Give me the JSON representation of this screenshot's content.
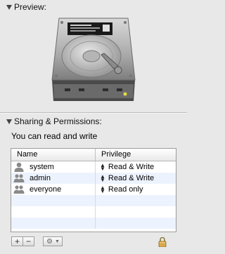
{
  "preview": {
    "title": "Preview:"
  },
  "sharing": {
    "title": "Sharing & Permissions:",
    "note": "You can read and write",
    "columns": {
      "name": "Name",
      "privilege": "Privilege"
    },
    "rows": [
      {
        "name": "system",
        "privilege": "Read & Write",
        "icon": "single-user-icon"
      },
      {
        "name": "admin",
        "privilege": "Read & Write",
        "icon": "group-icon"
      },
      {
        "name": "everyone",
        "privilege": "Read only",
        "icon": "group-icon"
      }
    ]
  },
  "toolbar": {
    "add_label": "+",
    "remove_label": "−",
    "action_label": "⚙"
  },
  "colors": {
    "background": "#e8e8e8",
    "stripe": "#edf3fe",
    "disk_light": "#cfcfcf",
    "disk_dark": "#555555",
    "led": "#e6d84a"
  }
}
